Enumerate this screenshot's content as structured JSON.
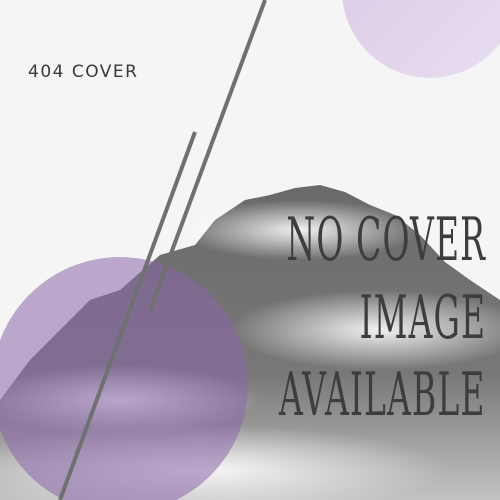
{
  "cover": {
    "tag": "404 COVER",
    "lines": [
      "NO COVER",
      "IMAGE",
      "AVAILABLE"
    ]
  },
  "colors": {
    "circle": "#cdb8dc",
    "circle_overlay": "#7b5a9a",
    "text": "#3d3d3d",
    "lines": "#6e6e6e",
    "mountain": "#4a4a4a"
  }
}
